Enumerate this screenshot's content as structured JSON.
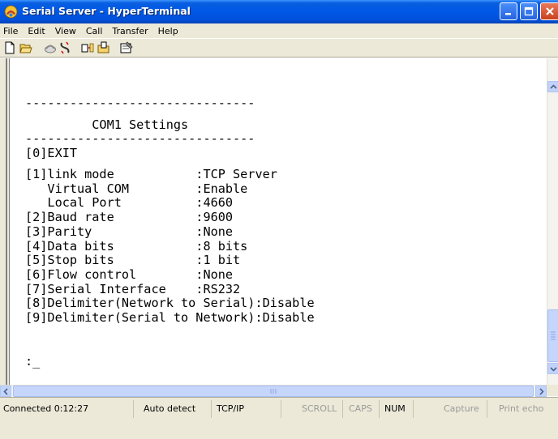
{
  "window": {
    "title": "Serial Server - HyperTerminal",
    "title_icon": "hyperterminal-phone-icon"
  },
  "menu": [
    {
      "label": "File"
    },
    {
      "label": "Edit"
    },
    {
      "label": "View"
    },
    {
      "label": "Call"
    },
    {
      "label": "Transfer"
    },
    {
      "label": "Help"
    }
  ],
  "toolbar": {
    "icons": [
      "new-icon",
      "open-icon",
      "connect-icon",
      "disconnect-icon",
      "send-icon",
      "receive-icon",
      "properties-icon"
    ]
  },
  "terminal": {
    "lines": [
      "-------------------------------",
      "         COM1 Settings",
      "-------------------------------",
      "[0]EXIT",
      "[1]link mode           :TCP Server",
      "   Virtual COM         :Enable",
      "   Local Port          :4660",
      "[2]Baud rate           :9600",
      "[3]Parity              :None",
      "[4]Data bits           :8 bits",
      "[5]Stop bits           :1 bit",
      "[6]Flow control        :None",
      "[7]Serial Interface    :RS232",
      "[8]Delimiter(Network to Serial):Disable",
      "[9]Delimiter(Serial to Network):Disable",
      ":_"
    ]
  },
  "status": {
    "connected": "Connected 0:12:27",
    "detect": "Auto detect",
    "protocol": "TCP/IP",
    "scroll": "SCROLL",
    "caps": "CAPS",
    "num": "NUM",
    "capture": "Capture",
    "print_echo": "Print echo"
  },
  "colors": {
    "titlebar": "#0058e6",
    "chrome": "#ece9d8",
    "close_button": "#c8421e"
  }
}
